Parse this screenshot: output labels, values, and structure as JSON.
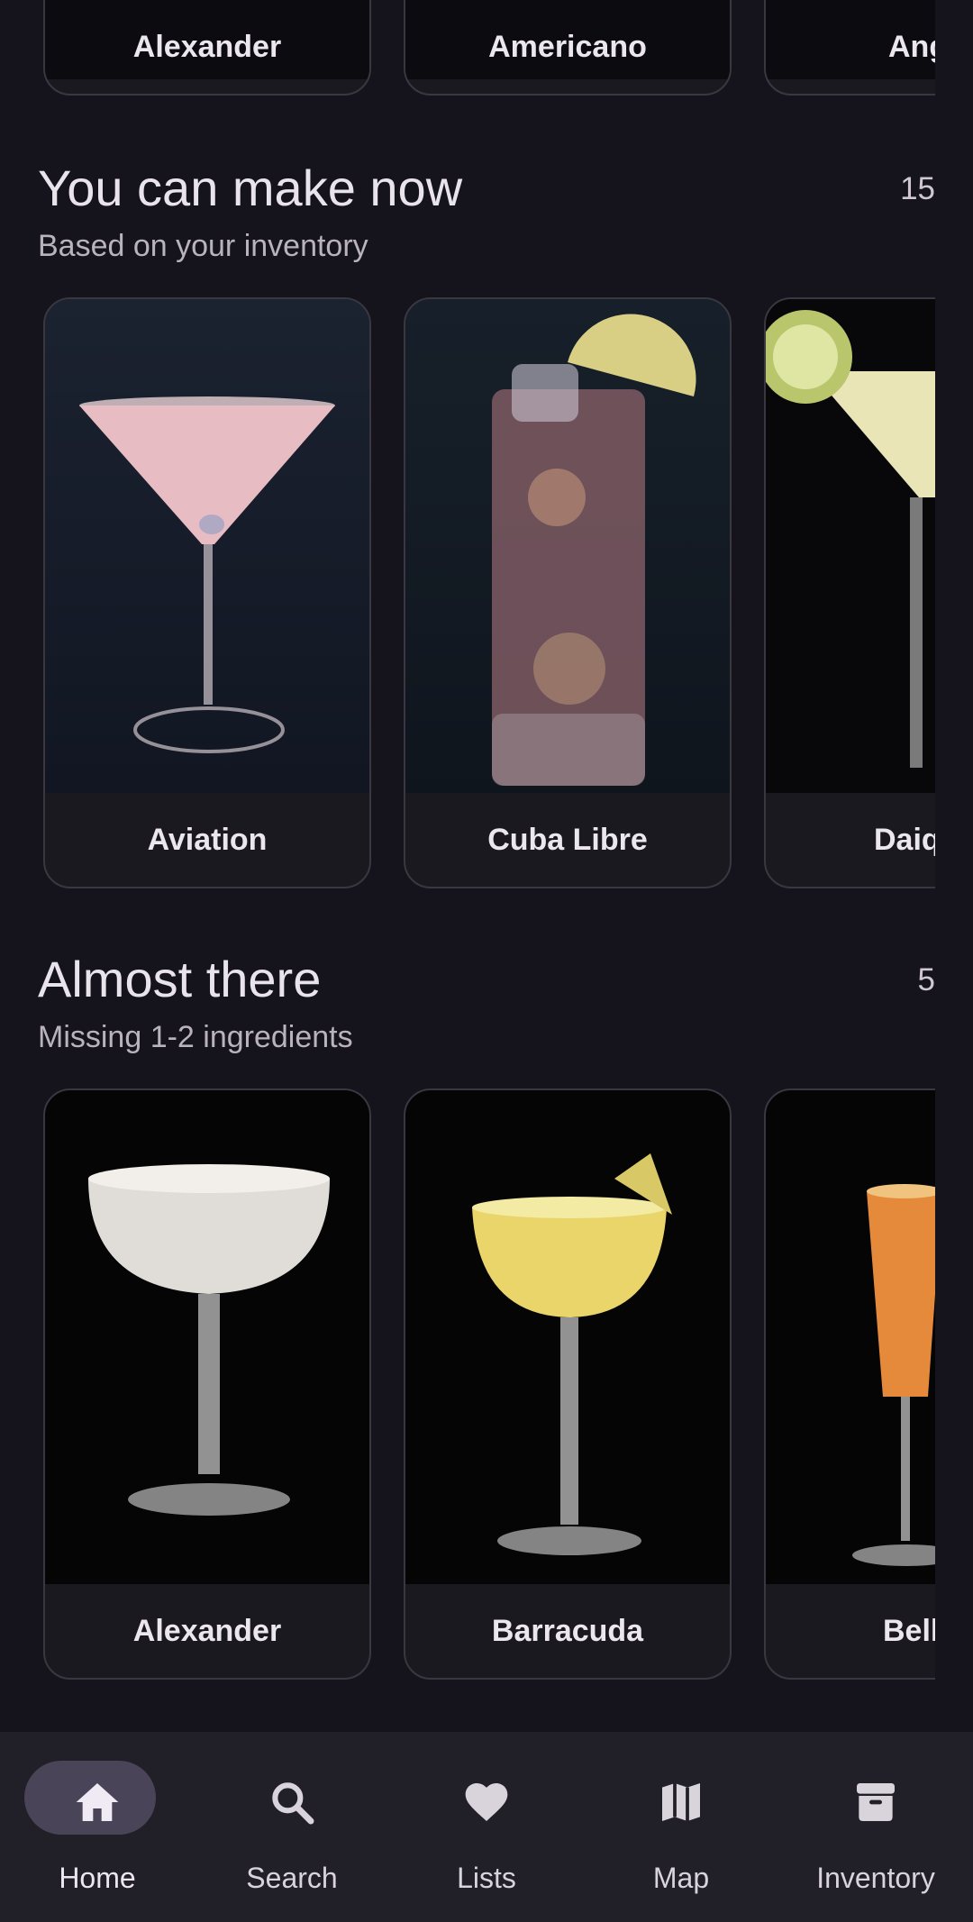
{
  "top_row": {
    "cards": [
      {
        "label": "Alexander"
      },
      {
        "label": "Americano"
      },
      {
        "label": "Angel"
      }
    ]
  },
  "make_now": {
    "title": "You can make now",
    "subtitle": "Based on your inventory",
    "count": "15",
    "cards": [
      {
        "label": "Aviation"
      },
      {
        "label": "Cuba Libre"
      },
      {
        "label": "Daiq"
      }
    ]
  },
  "almost_there": {
    "title": "Almost there",
    "subtitle": "Missing 1-2 ingredients",
    "count": "5",
    "cards": [
      {
        "label": "Alexander"
      },
      {
        "label": "Barracuda"
      },
      {
        "label": "Bell"
      }
    ]
  },
  "nav": {
    "active": "home",
    "items": [
      {
        "label": "Home",
        "icon": "home-icon"
      },
      {
        "label": "Search",
        "icon": "search-icon"
      },
      {
        "label": "Lists",
        "icon": "heart-icon"
      },
      {
        "label": "Map",
        "icon": "map-icon"
      },
      {
        "label": "Inventory",
        "icon": "archive-icon"
      }
    ]
  },
  "colors": {
    "background": "#15131b",
    "card": "#1b1920",
    "nav_bar": "#211f27",
    "nav_active_pill": "#4a4458"
  }
}
